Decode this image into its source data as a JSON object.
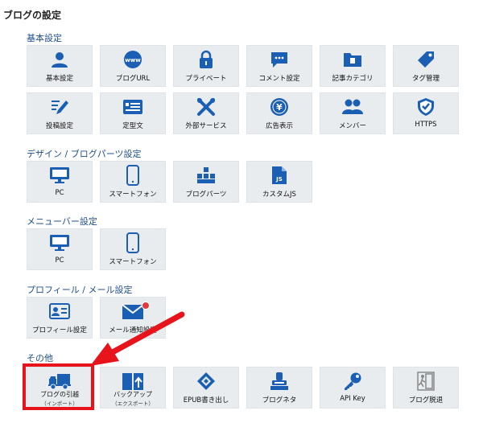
{
  "page_title": "ブログの設定",
  "sections": {
    "basic": {
      "title": "基本設定",
      "items": [
        "基本設定",
        "ブログURL",
        "プライベート",
        "コメント設定",
        "記事カテゴリ",
        "タグ管理",
        "投稿設定",
        "定型文",
        "外部サービス",
        "広告表示",
        "メンバー",
        "HTTPS"
      ]
    },
    "design": {
      "title": "デザイン / ブログパーツ設定",
      "items": [
        "PC",
        "スマートフォン",
        "ブログパーツ",
        "カスタムJS"
      ]
    },
    "menubar": {
      "title": "メニューバー設定",
      "items": [
        "PC",
        "スマートフォン"
      ]
    },
    "profile": {
      "title": "プロフィール / メール設定",
      "items": [
        "プロフィール設定",
        "メール通知設定"
      ]
    },
    "other": {
      "title": "その他",
      "items": [
        {
          "label": "ブログの引越",
          "sub": "（インポート）"
        },
        {
          "label": "バックアップ",
          "sub": "（エクスポート）"
        },
        {
          "label": "EPUB書き出し"
        },
        {
          "label": "ブログネタ"
        },
        {
          "label": "API Key"
        },
        {
          "label": "ブログ脱退"
        }
      ]
    }
  },
  "icon_color": "#1a5fb4",
  "highlight_color": "#e8141c",
  "icons": {
    "basic": [
      "user-icon",
      "www-globe-icon",
      "lock-icon",
      "comment-icon",
      "folder-icon",
      "tag-icon",
      "pen-icon",
      "template-icon",
      "tools-icon",
      "yen-coin-icon",
      "members-icon",
      "shield-check-icon"
    ],
    "design": [
      "monitor-icon",
      "smartphone-icon",
      "blog-parts-icon",
      "js-file-icon"
    ],
    "menubar": [
      "monitor-icon",
      "smartphone-icon"
    ],
    "profile": [
      "profile-card-icon",
      "mail-icon"
    ],
    "other": [
      "truck-icon",
      "backup-book-icon",
      "epub-icon",
      "stamp-icon",
      "key-icon",
      "exit-icon"
    ]
  }
}
